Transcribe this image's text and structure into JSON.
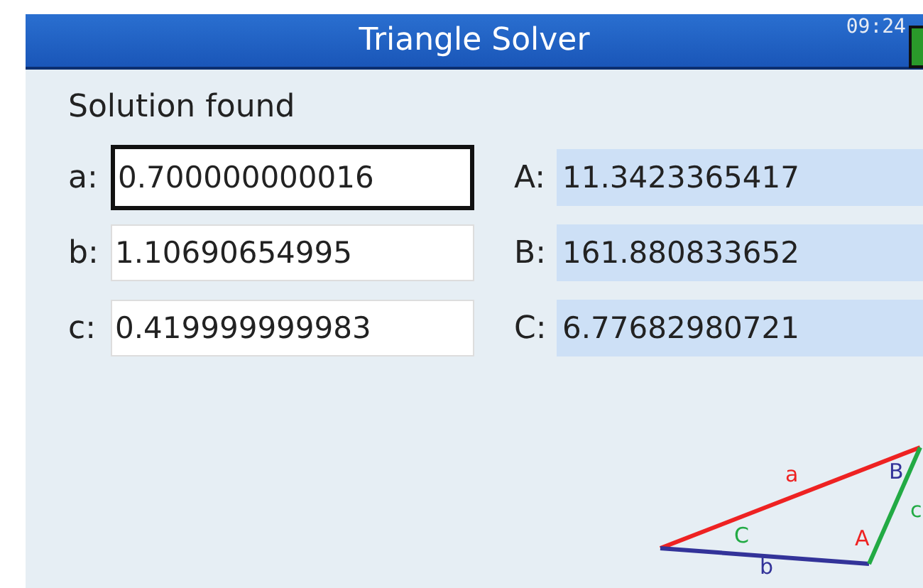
{
  "window": {
    "title": "Triangle Solver",
    "time": "09:24"
  },
  "status": "Solution found",
  "sides": [
    {
      "label": "a:",
      "value": "0.700000000016",
      "selected": true
    },
    {
      "label": "b:",
      "value": "1.10690654995",
      "selected": false
    },
    {
      "label": "c:",
      "value": "0.419999999983",
      "selected": false
    }
  ],
  "angles": [
    {
      "label": "A:",
      "value": "11.3423365417"
    },
    {
      "label": "B:",
      "value": "161.880833652"
    },
    {
      "label": "C:",
      "value": "6.77682980721"
    }
  ],
  "triangle_labels": [
    {
      "text": "a",
      "color": "#ee2222"
    },
    {
      "text": "b",
      "color": "#333399"
    },
    {
      "text": "c",
      "color": "#22aa44"
    },
    {
      "text": "A",
      "color": "#ee2222"
    },
    {
      "text": "B",
      "color": "#333399"
    },
    {
      "text": "C",
      "color": "#22aa44"
    }
  ]
}
